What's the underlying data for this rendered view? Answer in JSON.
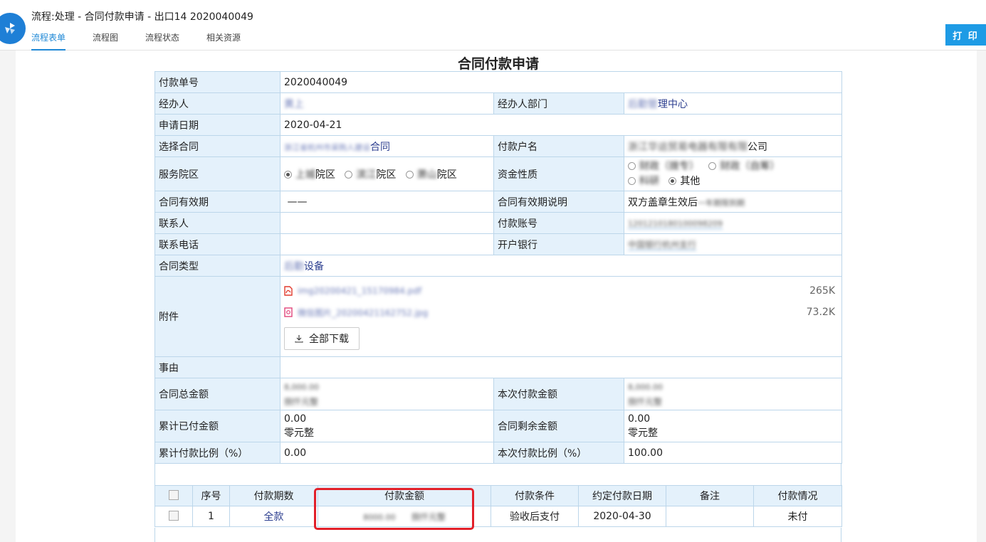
{
  "header": {
    "title": "流程:处理 - 合同付款申请 - 出口14 2020040049",
    "tabs": [
      "流程表单",
      "流程图",
      "流程状态",
      "相关资源"
    ],
    "print_label": "打 印"
  },
  "form": {
    "title": "合同付款申请",
    "pay_no_label": "付款单号",
    "pay_no": "2020040049",
    "handler_label": "经办人",
    "handler": "黄上",
    "dept_label": "经办人部门",
    "dept_prefix": "后勤管",
    "dept_suffix": "理中心",
    "date_label": "申请日期",
    "date": "2020-04-21",
    "contract_label": "选择合同",
    "contract_prefix": "浙江省杭州市采购人建设",
    "contract_suffix": "合同",
    "payee_label": "付款户名",
    "payee_prefix": "浙江华运贸易电器有限有限",
    "payee_suffix": "公司",
    "campus_label": "服务院区",
    "campus_options": [
      {
        "prefix": "上城",
        "suffix": "院区",
        "checked": true
      },
      {
        "prefix": "滨江",
        "suffix": "院区",
        "checked": false
      },
      {
        "prefix": "萧山",
        "suffix": "院区",
        "checked": false
      }
    ],
    "fund_label": "资金性质",
    "fund_options_row1": [
      {
        "text": "财政（拨专）",
        "checked": false,
        "blur": true
      },
      {
        "text": "财政（自筹）",
        "checked": false,
        "blur": true
      }
    ],
    "fund_options_row2": [
      {
        "text": "科研",
        "checked": false,
        "blur": true
      },
      {
        "text": "其他",
        "checked": true,
        "blur": false
      }
    ],
    "validity_label": "合同有效期",
    "validity": "——",
    "validity_note_label": "合同有效期说明",
    "validity_note_prefix": "双方盖章生效后",
    "validity_note_suffix": "一年期限到期",
    "contact_label": "联系人",
    "contact": "",
    "account_label": "付款账号",
    "account": "1201210180100098209",
    "phone_label": "联系电话",
    "phone": "",
    "bank_label": "开户银行",
    "bank": "中国银行杭州支行",
    "type_label": "合同类型",
    "type_prefix": "后勤",
    "type_suffix": "设备",
    "attach_label": "附件",
    "attachments": [
      {
        "name": "img20200421_15170984.pdf",
        "size": "265K",
        "kind": "pdf"
      },
      {
        "name": "微信图片_20200421162752.jpg",
        "size": "73.2K",
        "kind": "img"
      }
    ],
    "download_all": "全部下载",
    "reason_label": "事由",
    "reason": "",
    "total_label": "合同总金额",
    "total_num": "8,000.00",
    "total_cn": "捌仟元整",
    "this_label": "本次付款金额",
    "this_num": "8,000.00",
    "this_cn": "捌仟元整",
    "paid_label": "累计已付金额",
    "paid_num": "0.00",
    "paid_cn": "零元整",
    "remain_label": "合同剩余金额",
    "remain_num": "0.00",
    "remain_cn": "零元整",
    "ratio_label": "累计付款比例（%）",
    "ratio": "0.00",
    "this_ratio_label": "本次付款比例（%）",
    "this_ratio": "100.00"
  },
  "payments": {
    "headers": [
      "序号",
      "付款期数",
      "付款金额",
      "付款条件",
      "约定付款日期",
      "备注",
      "付款情况"
    ],
    "rows": [
      {
        "no": "1",
        "period": "全款",
        "amount": "8000.00",
        "amount_cn": "捌仟元整",
        "condition": "验收后支付",
        "date": "2020-04-30",
        "note": "",
        "status": "未付"
      }
    ]
  },
  "colors": {
    "accent": "#1e88d6",
    "label_bg": "#e4f1fb",
    "border": "#bcd6ea",
    "highlight": "#e2202a"
  }
}
